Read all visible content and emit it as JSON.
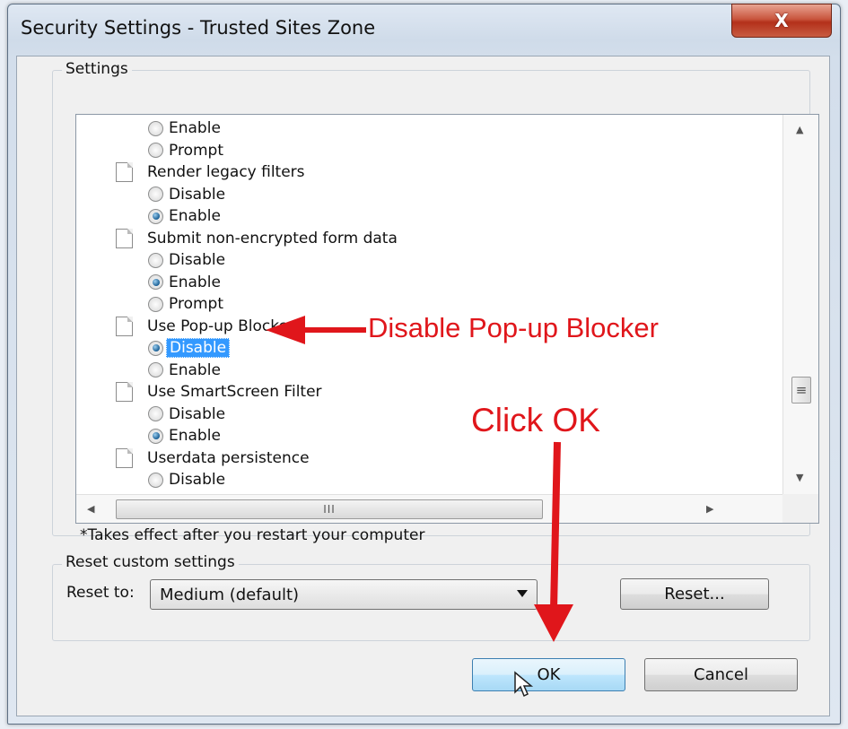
{
  "window": {
    "title": "Security Settings - Trusted Sites Zone",
    "close_glyph": "X"
  },
  "settings_group": {
    "label": "Settings",
    "items": [
      {
        "kind": "radio",
        "label": "Enable",
        "checked": false
      },
      {
        "kind": "radio",
        "label": "Prompt",
        "checked": false
      },
      {
        "kind": "setting",
        "label": "Render legacy filters"
      },
      {
        "kind": "radio",
        "label": "Disable",
        "checked": false
      },
      {
        "kind": "radio",
        "label": "Enable",
        "checked": true
      },
      {
        "kind": "setting",
        "label": "Submit non-encrypted form data"
      },
      {
        "kind": "radio",
        "label": "Disable",
        "checked": false
      },
      {
        "kind": "radio",
        "label": "Enable",
        "checked": true
      },
      {
        "kind": "radio",
        "label": "Prompt",
        "checked": false
      },
      {
        "kind": "setting",
        "label": "Use Pop-up Blocker"
      },
      {
        "kind": "radio",
        "label": "Disable",
        "checked": true,
        "selected": true
      },
      {
        "kind": "radio",
        "label": "Enable",
        "checked": false
      },
      {
        "kind": "setting",
        "label": "Use SmartScreen Filter"
      },
      {
        "kind": "radio",
        "label": "Disable",
        "checked": false
      },
      {
        "kind": "radio",
        "label": "Enable",
        "checked": true
      },
      {
        "kind": "setting",
        "label": "Userdata persistence"
      },
      {
        "kind": "radio",
        "label": "Disable",
        "checked": false
      }
    ],
    "hscroll_thumb_grip": "III",
    "note": "*Takes effect after you restart your computer"
  },
  "reset_group": {
    "label": "Reset custom settings",
    "reset_to_label": "Reset to:",
    "reset_to_value": "Medium (default)",
    "reset_button": "Reset..."
  },
  "buttons": {
    "ok": "OK",
    "cancel": "Cancel"
  },
  "annotations": {
    "popup_callout": "Disable Pop-up Blocker",
    "ok_callout": "Click OK",
    "color": "#e0161b"
  },
  "colors": {
    "selection": "#3399ff",
    "close_button": "#c9563e"
  }
}
